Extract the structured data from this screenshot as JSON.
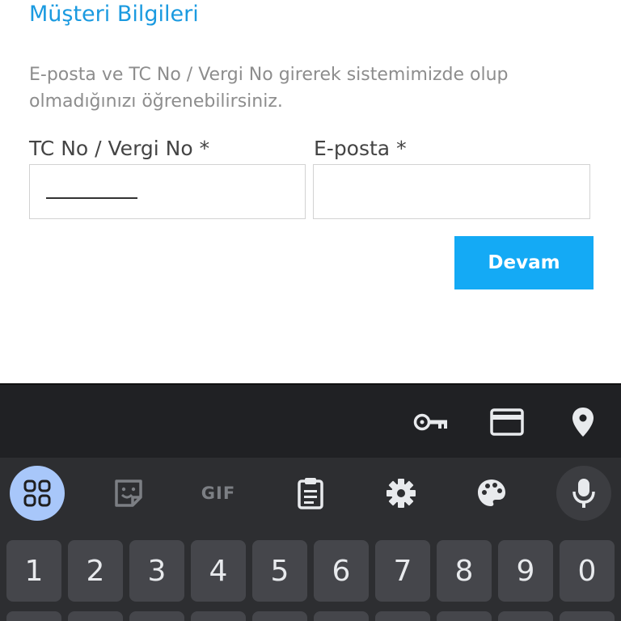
{
  "form": {
    "title": "Müşteri Bilgileri",
    "help_text": "E-posta ve TC No / Vergi No girerek sistemimizde olup olmadığınızı öğrenebilirsiniz.",
    "tc_label": "TC No / Vergi No *",
    "tc_value": "",
    "email_label": "E-posta *",
    "email_value": "",
    "submit_label": "Devam"
  },
  "keyboard": {
    "autofill_icons": [
      "key-icon",
      "credit-card-icon",
      "location-pin-icon"
    ],
    "toolbar": {
      "apps_icon": "apps-grid-icon",
      "sticker_icon": "sticker-icon",
      "gif_label": "GIF",
      "clipboard_icon": "clipboard-icon",
      "settings_icon": "gear-icon",
      "theme_icon": "palette-icon",
      "mic_icon": "mic-icon"
    },
    "number_row": [
      "1",
      "2",
      "3",
      "4",
      "5",
      "6",
      "7",
      "8",
      "9",
      "0"
    ]
  },
  "colors": {
    "accent": "#1a9ae0",
    "button": "#14aaf5",
    "keyboard_bg": "#2d2e31",
    "key_bg": "#45464b"
  }
}
